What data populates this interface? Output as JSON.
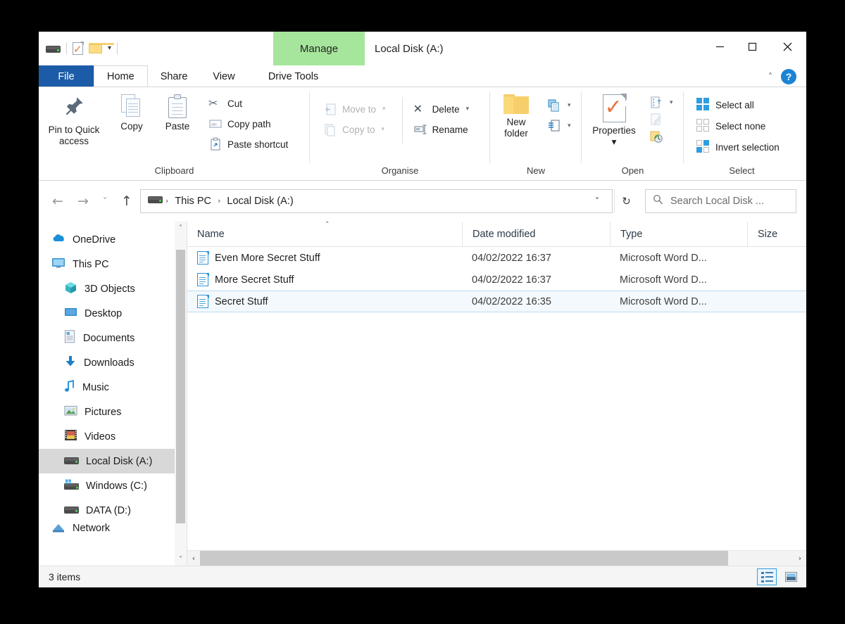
{
  "window": {
    "title": "Local Disk (A:)",
    "contextual_tab_header": "Manage",
    "controls": {
      "minimize": "─",
      "maximize": "☐",
      "close": "✕"
    }
  },
  "quick_access_toolbar": {
    "items": [
      "drive-icon",
      "properties-icon",
      "new-folder-icon"
    ],
    "dropdown": "▾"
  },
  "tabs": [
    {
      "label": "File"
    },
    {
      "label": "Home"
    },
    {
      "label": "Share"
    },
    {
      "label": "View"
    },
    {
      "label": "Drive Tools"
    }
  ],
  "ribbon_controls": {
    "collapse_chevron": "˄",
    "help_label": "?"
  },
  "ribbon": {
    "groups": [
      {
        "name": "Clipboard",
        "big_buttons": [
          {
            "label": "Pin to Quick\naccess",
            "line1": "Pin to Quick",
            "line2": "access",
            "disabled": false
          },
          {
            "label": "Copy",
            "disabled": false
          },
          {
            "label": "Paste",
            "disabled": false
          }
        ],
        "small_buttons": [
          {
            "label": "Cut",
            "disabled": false
          },
          {
            "label": "Copy path",
            "disabled": false
          },
          {
            "label": "Paste shortcut",
            "disabled": false
          }
        ]
      },
      {
        "name": "Organise",
        "small_buttons_left": [
          {
            "label": "Move to",
            "caret": "▾",
            "disabled": true
          },
          {
            "label": "Copy to",
            "caret": "▾",
            "disabled": true
          }
        ],
        "small_buttons_right": [
          {
            "label": "Delete",
            "caret": "▾",
            "disabled": false
          },
          {
            "label": "Rename",
            "disabled": false
          }
        ]
      },
      {
        "name": "New",
        "big_buttons": [
          {
            "line1": "New",
            "line2": "folder"
          }
        ],
        "small_buttons": [
          {
            "label": "",
            "icon": "new-item-icon",
            "caret": "▾"
          },
          {
            "label": "",
            "icon": "easy-access-icon",
            "caret": "▾"
          }
        ]
      },
      {
        "name": "Open",
        "big_buttons": [
          {
            "line1": "Properties",
            "caret": "▾"
          }
        ],
        "small_buttons": [
          {
            "label": "",
            "icon": "open-icon",
            "caret": "▾"
          },
          {
            "label": "",
            "icon": "edit-icon"
          },
          {
            "label": "",
            "icon": "history-icon"
          }
        ]
      },
      {
        "name": "Select",
        "small_buttons": [
          {
            "label": "Select all"
          },
          {
            "label": "Select none"
          },
          {
            "label": "Invert selection"
          }
        ]
      }
    ]
  },
  "address_bar": {
    "back": "←",
    "forward": "→",
    "recent": "˅",
    "up": "↑",
    "breadcrumbs": [
      "This PC",
      "Local Disk (A:)"
    ],
    "separator": "›",
    "dropdown": "˅",
    "refresh": "↻"
  },
  "search": {
    "placeholder": "Search Local Disk ...",
    "value": "",
    "icon": "search-icon"
  },
  "navigation_pane": {
    "items": [
      {
        "label": "OneDrive",
        "icon": "onedrive-icon",
        "indent": false,
        "selected": false
      },
      {
        "label": "This PC",
        "icon": "this-pc-icon",
        "indent": false,
        "selected": false
      },
      {
        "label": "3D Objects",
        "icon": "3d-objects-icon",
        "indent": true,
        "selected": false
      },
      {
        "label": "Desktop",
        "icon": "desktop-icon",
        "indent": true,
        "selected": false
      },
      {
        "label": "Documents",
        "icon": "documents-icon",
        "indent": true,
        "selected": false
      },
      {
        "label": "Downloads",
        "icon": "downloads-icon",
        "indent": true,
        "selected": false
      },
      {
        "label": "Music",
        "icon": "music-icon",
        "indent": true,
        "selected": false
      },
      {
        "label": "Pictures",
        "icon": "pictures-icon",
        "indent": true,
        "selected": false
      },
      {
        "label": "Videos",
        "icon": "videos-icon",
        "indent": true,
        "selected": false
      },
      {
        "label": "Local Disk (A:)",
        "icon": "drive-icon",
        "indent": true,
        "selected": true
      },
      {
        "label": "Windows (C:)",
        "icon": "windows-drive-icon",
        "indent": true,
        "selected": false
      },
      {
        "label": "DATA (D:)",
        "icon": "drive-icon",
        "indent": true,
        "selected": false
      },
      {
        "label": "Network",
        "icon": "network-icon",
        "indent": false,
        "selected": false
      }
    ],
    "scroll_up": "˄",
    "scroll_down": "˅"
  },
  "file_list": {
    "columns": [
      "Name",
      "Date modified",
      "Type",
      "Size"
    ],
    "sort_indicator": "˄",
    "sort_column": "Name",
    "rows": [
      {
        "name": "Even More Secret Stuff",
        "date_modified": "04/02/2022 16:37",
        "type": "Microsoft Word D...",
        "size": "",
        "icon": "word-document-icon",
        "focused": false
      },
      {
        "name": "More Secret Stuff",
        "date_modified": "04/02/2022 16:37",
        "type": "Microsoft Word D...",
        "size": "",
        "icon": "word-document-icon",
        "focused": false
      },
      {
        "name": "Secret Stuff",
        "date_modified": "04/02/2022 16:35",
        "type": "Microsoft Word D...",
        "size": "",
        "icon": "word-document-icon",
        "focused": true
      }
    ],
    "h_scroll_left": "‹",
    "h_scroll_right": "›"
  },
  "status_bar": {
    "item_count": "3 items",
    "view_buttons": [
      {
        "name": "details-view",
        "selected": true
      },
      {
        "name": "large-icons-view",
        "selected": false
      }
    ]
  },
  "colors": {
    "file_tab_blue": "#1c5ba8",
    "manage_green": "#a6e69c",
    "accent_blue": "#2f9ee0",
    "selection_row": "#f4f9fd",
    "selection_border": "#bcdcf3",
    "nav_selected": "#d8d8d8",
    "help_blue": "#1c83d4",
    "properties_orange": "#e8733f"
  }
}
